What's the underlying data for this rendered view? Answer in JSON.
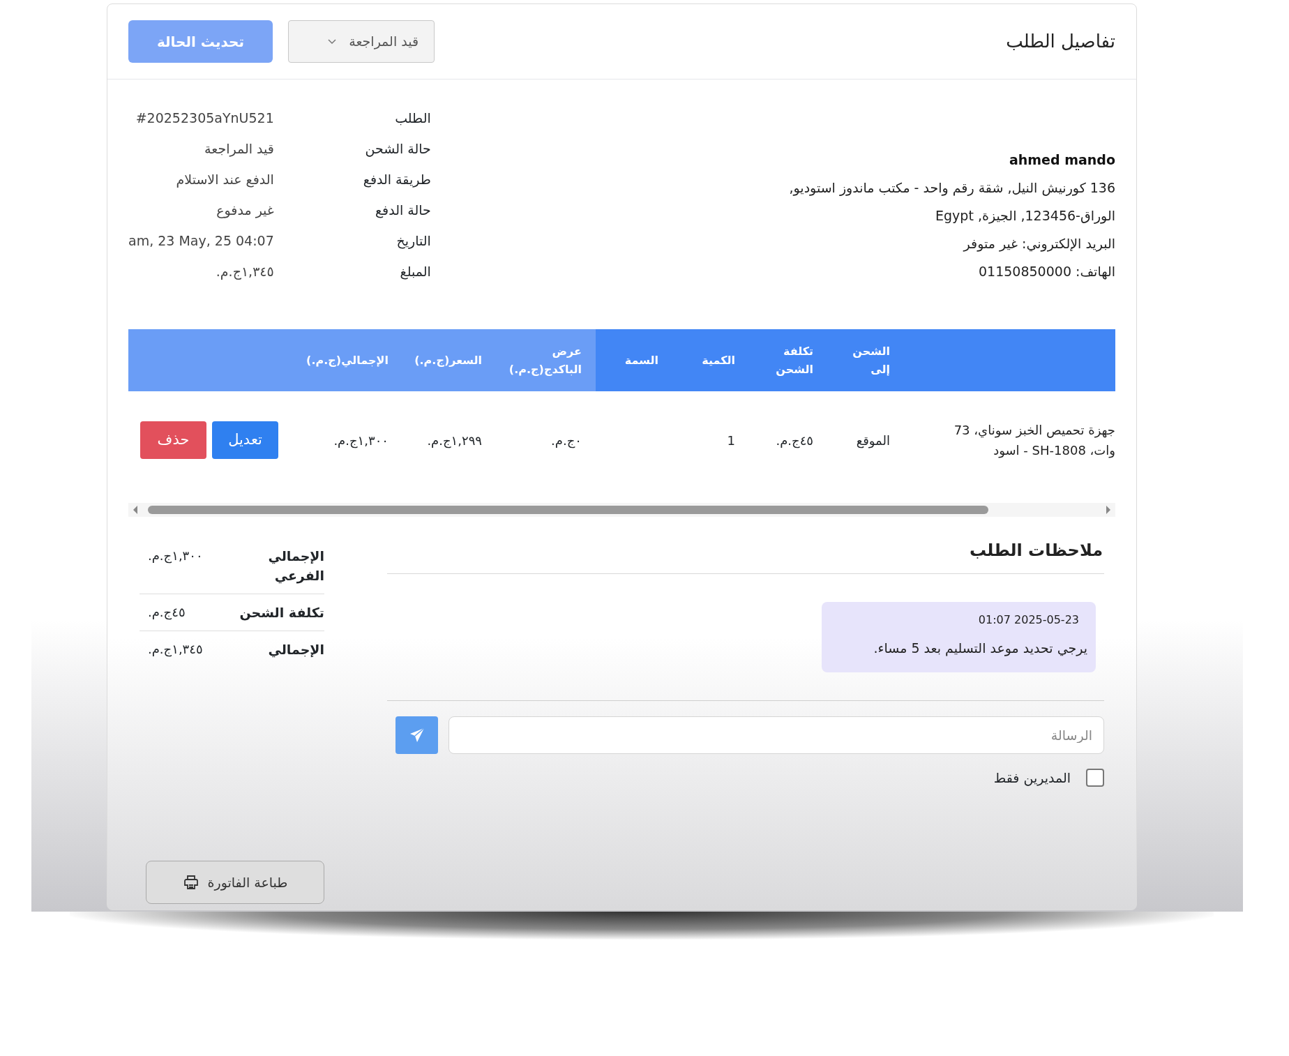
{
  "header": {
    "title": "تفاصيل الطلب",
    "status_select": {
      "value": "قيد المراجعة"
    },
    "update_button": {
      "label": "تحديث الحالة",
      "disabled": true
    }
  },
  "order_info": [
    {
      "label": "الطلب",
      "value": "#20252305aYnU521"
    },
    {
      "label": "حالة الشحن",
      "value": "قيد المراجعة"
    },
    {
      "label": "طريقة الدفع",
      "value": "الدفع عند الاستلام"
    },
    {
      "label": "حالة الدفع",
      "value": "غير مدفوع"
    },
    {
      "label": "التاريخ",
      "value": "am, 23 May, 25 04:07"
    },
    {
      "label": "المبلغ",
      "value": "١,٣٤٥ج.م."
    }
  ],
  "customer": {
    "name": "ahmed mando",
    "lines": [
      "136 كورنيش النيل, شقة رقم واحد - مكتب ماندوز استوديو,",
      "الوراق-123456, الجيزة, Egypt",
      "البريد الإلكتروني: غير متوفر",
      "الهاتف: 01150850000"
    ]
  },
  "table": {
    "columns": [
      "الشحن إلى",
      "تكلفة الشحن",
      "الكمية",
      "السمة",
      "عرض الباكدج(ج.م.)",
      "السعر(ج.م.)",
      "الإجمالي(ج.م.)"
    ],
    "rows": [
      {
        "product": "جهزة تحميص الخبز سوناي، 73 وات، SH-1808 - اسود",
        "cells": [
          "الموقع",
          "٤٥ج.م.",
          "1",
          null,
          "٠ج.م.",
          "١,٢٩٩ج.م.",
          "١,٣٠٠ج.م."
        ],
        "actions": [
          {
            "label": "تعديل",
            "kind": "edit"
          },
          {
            "label": "حذف",
            "kind": "delete"
          }
        ]
      }
    ]
  },
  "notes": {
    "title": "ملاحظات الطلب",
    "messages": [
      {
        "time": "2025-05-23 01:07",
        "text": "يرجي تحديد موعد التسليم بعد 5 مساء."
      }
    ],
    "input": {
      "placeholder": "الرسالة"
    },
    "admins_only": {
      "label": "المديرين فقط",
      "checked": false
    }
  },
  "summary": [
    {
      "label": "الإجمالي الفرعي",
      "value": "١,٣٠٠ج.م."
    },
    {
      "label": "تكلفة الشحن",
      "value": "٤٥ج.م."
    },
    {
      "label": "الإجمالي",
      "value": "١,٣٤٥ج.م."
    }
  ],
  "print_button": {
    "label": "طباعة الفاتورة"
  }
}
